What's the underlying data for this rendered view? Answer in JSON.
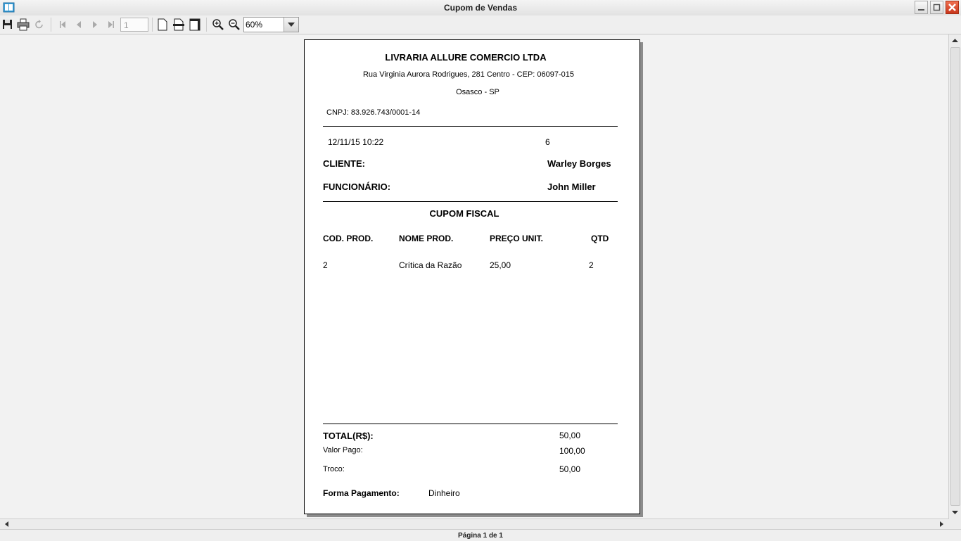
{
  "window": {
    "title": "Cupom de Vendas"
  },
  "toolbar": {
    "page_number": "1",
    "zoom_value": "60%"
  },
  "status": {
    "page_info": "Página 1 de 1"
  },
  "colors": {
    "close_button": "#c8361c",
    "app_icon": "#3a9fd8"
  },
  "receipt": {
    "company_name": "LIVRARIA ALLURE COMERCIO LTDA",
    "address": "Rua Virginia Aurora Rodrigues, 281 Centro - CEP: 06097-015",
    "city": "Osasco - SP",
    "cnpj": "CNPJ: 83.926.743/0001-14",
    "datetime": "12/11/15 10:22",
    "sale_number": "6",
    "client_label": "CLIENTE:",
    "client_name": "Warley Borges",
    "employee_label": "FUNCIONÁRIO:",
    "employee_name": "John Miller",
    "section_title": "CUPOM FISCAL",
    "columns": [
      "COD. PROD.",
      "NOME PROD.",
      "PREÇO UNIT.",
      "QTD"
    ],
    "items": [
      {
        "code": "2",
        "name": "Crítica da Razão",
        "unit_price": "25,00",
        "qty": "2"
      }
    ],
    "total_label": "TOTAL(R$):",
    "total_value": "50,00",
    "paid_label": "Valor Pago:",
    "paid_value": "100,00",
    "change_label": "Troco:",
    "change_value": "50,00",
    "payment_label": "Forma Pagamento:",
    "payment_value": "Dinheiro"
  }
}
